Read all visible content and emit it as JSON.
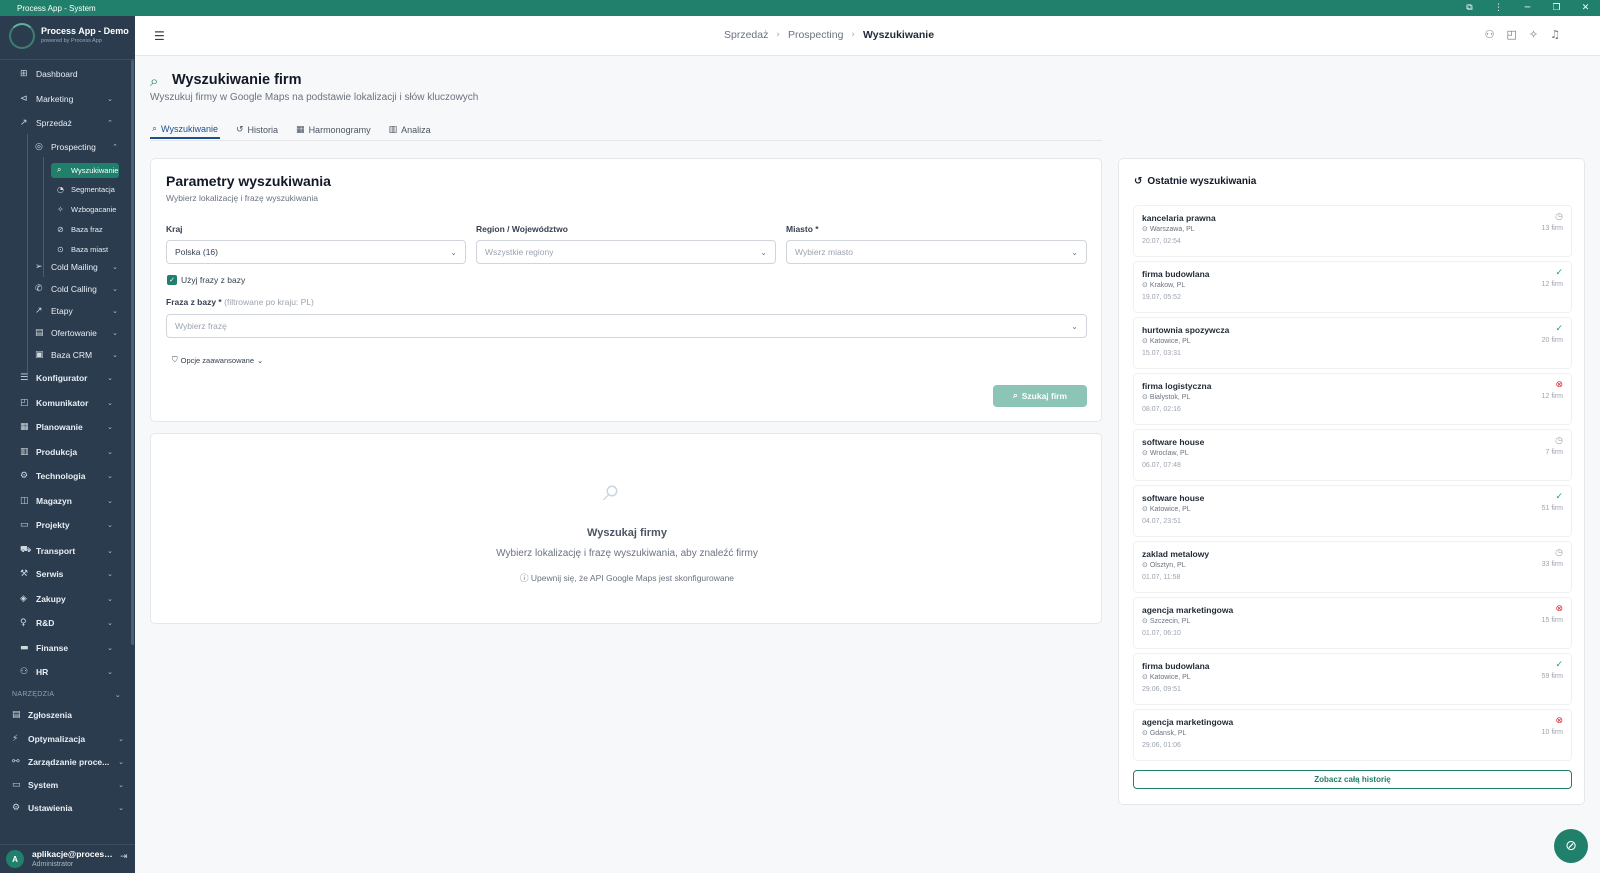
{
  "window": {
    "title": "Process App - System",
    "controls": [
      "⧉",
      "⋮",
      "─",
      "❐",
      "✕"
    ]
  },
  "app": {
    "name": "Process App - Demo",
    "tagline": "powered by Process App"
  },
  "nav": {
    "dashboard": "Dashboard",
    "marketing": "Marketing",
    "sprzedaz": "Sprzedaż",
    "prospecting": "Prospecting",
    "wyszukiwanie": "Wyszukiwanie",
    "segmentacja": "Segmentacja",
    "wzbogacanie": "Wzbogacanie",
    "baza_fraz": "Baza fraz",
    "baza_miast": "Baza miast",
    "cold_mailing": "Cold Mailing",
    "cold_calling": "Cold Calling",
    "etapy": "Etapy",
    "ofertowanie": "Ofertowanie",
    "baza_crm": "Baza CRM",
    "konfigurator": "Konfigurator",
    "komunikator": "Komunikator",
    "planowanie": "Planowanie",
    "produkcja": "Produkcja",
    "technologia": "Technologia",
    "magazyn": "Magazyn",
    "projekty": "Projekty",
    "transport": "Transport",
    "serwis": "Serwis",
    "zakupy": "Zakupy",
    "rd": "R&D",
    "finanse": "Finanse",
    "hr": "HR",
    "section_tools": "NARZĘDZIA",
    "zgloszenia": "Zgłoszenia",
    "optymalizacja": "Optymalizacja",
    "zarzadzanie": "Zarządzanie proce...",
    "system": "System",
    "ustawienia": "Ustawienia"
  },
  "user": {
    "initial": "A",
    "email": "aplikacje@process...",
    "role": "Administrator"
  },
  "breadcrumb": [
    "Sprzedaż",
    "Prospecting",
    "Wyszukiwanie"
  ],
  "page": {
    "title": "Wyszukiwanie firm",
    "subtitle": "Wyszukuj firmy w Google Maps na podstawie lokalizacji i słów kluczowych",
    "tabs": [
      "Wyszukiwanie",
      "Historia",
      "Harmonogramy",
      "Analiza"
    ]
  },
  "params": {
    "title": "Parametry wyszukiwania",
    "subtitle": "Wybierz lokalizację i frazę wyszukiwania",
    "country_label": "Kraj",
    "country_value": "Polska (16)",
    "region_label": "Region / Województwo",
    "region_placeholder": "Wszystkie regiony",
    "city_label": "Miasto *",
    "city_placeholder": "Wybierz miasto",
    "use_phrases_label": "Użyj frazy z bazy",
    "phrase_label": "Fraza z bazy *",
    "phrase_hint": "(filtrowane po kraju: PL)",
    "phrase_placeholder": "Wybierz frazę",
    "advanced_label": "Opcje zaawansowane",
    "search_button": "Szukaj firm"
  },
  "empty": {
    "title": "Wyszukaj firmy",
    "subtitle": "Wybierz lokalizację i frazę wyszukiwania, aby znaleźć firmy",
    "note": "Upewnij się, że API Google Maps jest skonfigurowane"
  },
  "recent": {
    "title": "Ostatnie wyszukiwania",
    "items": [
      {
        "name": "kancelaria prawna",
        "location": "Warszawa, PL",
        "date": "20.07, 02:54",
        "count": "13 firm",
        "status": "pending"
      },
      {
        "name": "firma budowlana",
        "location": "Krakow, PL",
        "date": "19.07, 05:52",
        "count": "12 firm",
        "status": "success"
      },
      {
        "name": "hurtownia spozywcza",
        "location": "Katowice, PL",
        "date": "15.07, 03:31",
        "count": "20 firm",
        "status": "success"
      },
      {
        "name": "firma logistyczna",
        "location": "Bialystok, PL",
        "date": "08.07, 02:16",
        "count": "12 firm",
        "status": "error"
      },
      {
        "name": "software house",
        "location": "Wroclaw, PL",
        "date": "06.07, 07:48",
        "count": "7 firm",
        "status": "pending"
      },
      {
        "name": "software house",
        "location": "Katowice, PL",
        "date": "04.07, 23:51",
        "count": "51 firm",
        "status": "success"
      },
      {
        "name": "zaklad metalowy",
        "location": "Olsztyn, PL",
        "date": "01.07, 11:58",
        "count": "33 firm",
        "status": "pending"
      },
      {
        "name": "agencja marketingowa",
        "location": "Szczecin, PL",
        "date": "01.07, 06:10",
        "count": "15 firm",
        "status": "error"
      },
      {
        "name": "firma budowlana",
        "location": "Katowice, PL",
        "date": "29.06, 09:51",
        "count": "59 firm",
        "status": "success"
      },
      {
        "name": "agencja marketingowa",
        "location": "Gdansk, PL",
        "date": "29.06, 01:06",
        "count": "10 firm",
        "status": "error"
      }
    ],
    "history_button": "Zobacz całą historię"
  },
  "status_colors": {
    "pending": "#9ca3af",
    "success": "#22a06b",
    "error": "#dc2626"
  },
  "status_icons": {
    "pending": "clock-icon",
    "success": "check-circle-icon",
    "error": "x-circle-icon"
  },
  "accent": "#20806b"
}
